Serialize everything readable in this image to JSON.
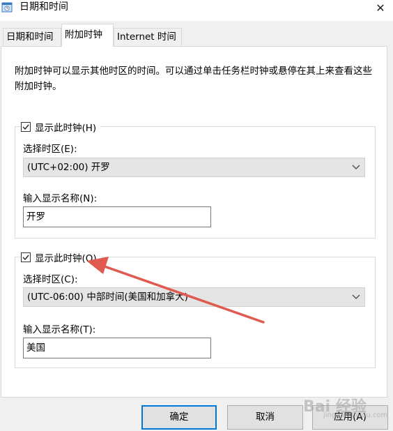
{
  "window": {
    "title": "日期和时间",
    "close_glyph": "✕"
  },
  "tabs": [
    {
      "label": "日期和时间",
      "active": false
    },
    {
      "label": "附加时钟",
      "active": true
    },
    {
      "label": "Internet 时间",
      "active": false
    }
  ],
  "description": "附加时钟可以显示其他时区的时间。可以通过单击任务栏时钟或悬停在其上来查看这些附加时钟。",
  "clock1": {
    "show_label": "显示此时钟(H)",
    "checked": true,
    "timezone_label": "选择时区(E):",
    "timezone_value": "(UTC+02:00) 开罗",
    "name_label": "输入显示名称(N):",
    "name_value": "开罗"
  },
  "clock2": {
    "show_label": "显示此时钟(O)",
    "checked": true,
    "timezone_label": "选择时区(C):",
    "timezone_value": "(UTC-06:00) 中部时间(美国和加拿大)",
    "name_label": "输入显示名称(T):",
    "name_value": "美国"
  },
  "buttons": {
    "ok": "确定",
    "cancel": "取消",
    "apply": "应用(A)"
  },
  "annotation": {
    "arrow_color": "#e05a4f"
  },
  "watermark": {
    "text": "Bai 经验",
    "sub": "jingyan.baidu.com"
  }
}
